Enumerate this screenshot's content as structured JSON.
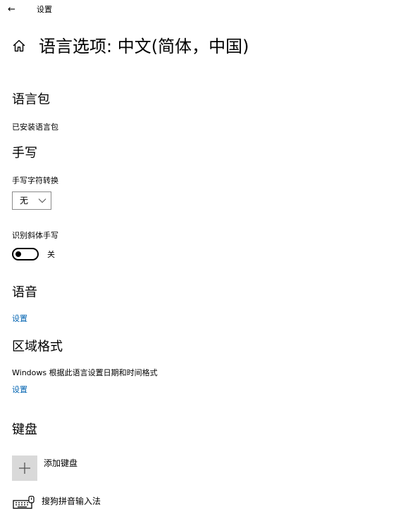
{
  "topbar": {
    "back_glyph": "←",
    "title": "设置"
  },
  "page": {
    "title": "语言选项: 中文(简体，中国)",
    "home_icon": "home-icon"
  },
  "language_pack": {
    "heading": "语言包",
    "status": "已安装语言包"
  },
  "handwriting": {
    "heading": "手写",
    "conversion_label": "手写字符转换",
    "conversion_value": "无",
    "italic_label": "识别斜体手写",
    "italic_state": "关"
  },
  "speech": {
    "heading": "语音",
    "settings_link": "设置"
  },
  "regional_format": {
    "heading": "区域格式",
    "description": "Windows 根据此语言设置日期和时间格式",
    "settings_link": "设置"
  },
  "keyboard": {
    "heading": "键盘",
    "add_label": "添加键盘",
    "installed": [
      {
        "name": "搜狗拼音输入法",
        "icon": "keyboard-icon"
      }
    ]
  },
  "colors": {
    "accent_link": "#0063b1",
    "add_tile": "#d9d9d9"
  }
}
